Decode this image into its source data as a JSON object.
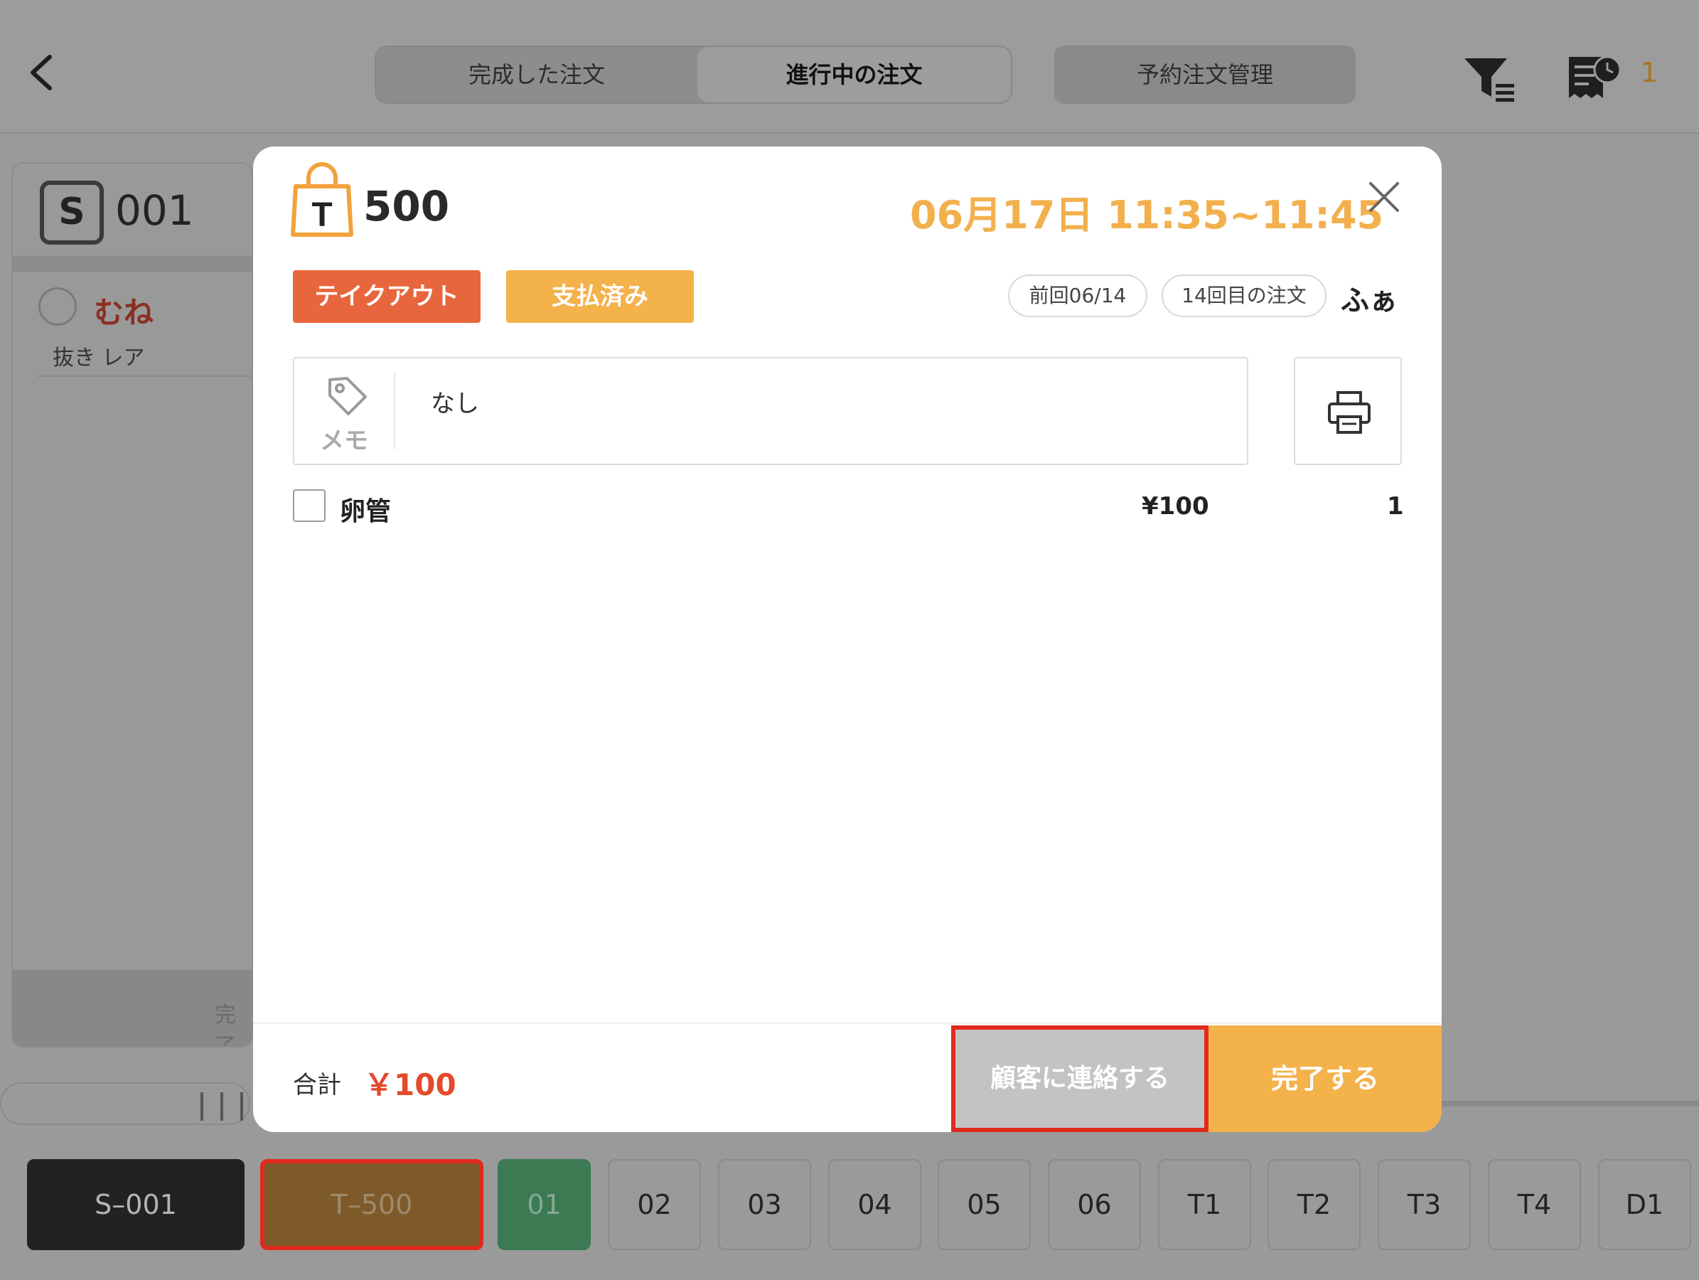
{
  "header": {
    "tabs": [
      {
        "label": "完成した注文",
        "active": false
      },
      {
        "label": "進行中の注文",
        "active": true
      }
    ],
    "reservation_label": "予約注文管理",
    "notification_count": "1",
    "icons": {
      "back": "chevron-left-icon",
      "filter": "filter-icon",
      "receipt": "receipt-clock-icon"
    }
  },
  "background_card": {
    "badge": "S",
    "number": "001",
    "item_name": "むね",
    "item_note": "抜き レア",
    "complete_label": "完了"
  },
  "table_bar": {
    "items": [
      {
        "label": "S–001",
        "state": "dark"
      },
      {
        "label": "T–500",
        "state": "selected"
      },
      {
        "label": "01",
        "state": "green"
      },
      {
        "label": "02",
        "state": "normal"
      },
      {
        "label": "03",
        "state": "normal"
      },
      {
        "label": "04",
        "state": "normal"
      },
      {
        "label": "05",
        "state": "normal"
      },
      {
        "label": "06",
        "state": "normal"
      },
      {
        "label": "T1",
        "state": "normal"
      },
      {
        "label": "T2",
        "state": "normal"
      },
      {
        "label": "T3",
        "state": "normal"
      },
      {
        "label": "T4",
        "state": "normal"
      },
      {
        "label": "D1",
        "state": "normal"
      }
    ]
  },
  "modal": {
    "bag_letter": "T",
    "order_number": "500",
    "time_range": "06月17日 11:35~11:45",
    "tags": {
      "takeout": "テイクアウト",
      "paid": "支払済み"
    },
    "last_visit": "前回06/14",
    "order_count": "14回目の注文",
    "customer_name": "ふぁ",
    "memo": {
      "label": "メモ",
      "text": "なし"
    },
    "items": [
      {
        "name": "卵管",
        "price": "¥100",
        "qty": "1"
      }
    ],
    "total_label": "合計",
    "total_value": "￥100",
    "contact_button": "顧客に連絡する",
    "complete_button": "完了する"
  },
  "colors": {
    "accent_orange": "#f4b24b",
    "takeout_tag": "#e8663d",
    "total_red": "#e24a2c",
    "highlight_red": "#e02a1d"
  }
}
